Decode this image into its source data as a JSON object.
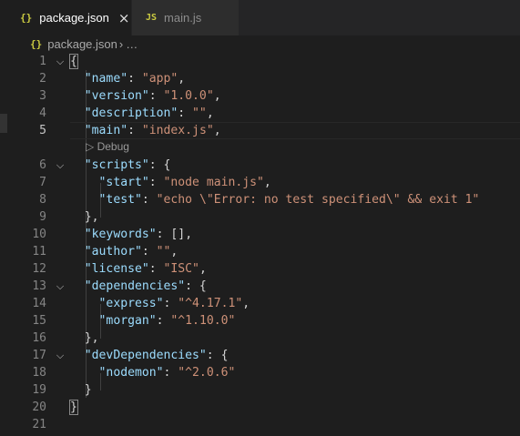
{
  "tabs": [
    {
      "label": "package.json",
      "icon": "{}",
      "active": true,
      "close": "×"
    },
    {
      "label": "main.js",
      "icon": "JS",
      "active": false
    }
  ],
  "breadcrumb": {
    "icon": "{}",
    "file": "package.json",
    "separator": "›",
    "more": "…"
  },
  "codelens": {
    "arrow": "▷",
    "label": "Debug"
  },
  "line_numbers": [
    "1",
    "2",
    "3",
    "4",
    "5",
    "6",
    "7",
    "8",
    "9",
    "10",
    "11",
    "12",
    "13",
    "14",
    "15",
    "16",
    "17",
    "18",
    "19",
    "20",
    "21"
  ],
  "colors": {
    "key": "#9cdcfe",
    "string": "#ce9178",
    "punct": "#d4d4d4",
    "background": "#1e1e1e"
  },
  "code": {
    "l1": "{",
    "l2": {
      "k": "\"name\"",
      "v": "\"app\""
    },
    "l3": {
      "k": "\"version\"",
      "v": "\"1.0.0\""
    },
    "l4": {
      "k": "\"description\"",
      "v": "\"\""
    },
    "l5": {
      "k": "\"main\"",
      "v": "\"index.js\""
    },
    "l6": {
      "k": "\"scripts\""
    },
    "l7": {
      "k": "\"start\"",
      "v": "\"node main.js\""
    },
    "l8": {
      "k": "\"test\"",
      "v": "\"echo \\\"Error: no test specified\\\" && exit 1\""
    },
    "l10": {
      "k": "\"keywords\"",
      "v": "[]"
    },
    "l11": {
      "k": "\"author\"",
      "v": "\"\""
    },
    "l12": {
      "k": "\"license\"",
      "v": "\"ISC\""
    },
    "l13": {
      "k": "\"dependencies\""
    },
    "l14": {
      "k": "\"express\"",
      "v": "\"^4.17.1\""
    },
    "l15": {
      "k": "\"morgan\"",
      "v": "\"^1.10.0\""
    },
    "l17": {
      "k": "\"devDependencies\""
    },
    "l18": {
      "k": "\"nodemon\"",
      "v": "\"^2.0.6\""
    },
    "l20": "}"
  }
}
